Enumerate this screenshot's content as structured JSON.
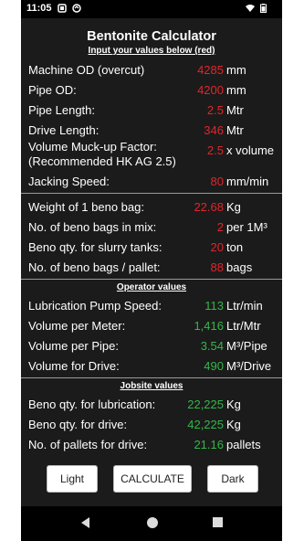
{
  "status": {
    "time": "11:05"
  },
  "app": {
    "title": "Bentonite Calculator",
    "subtitle": "Input your values below (red)"
  },
  "inputs": [
    {
      "label": "Machine OD (overcut)",
      "value": "4285",
      "unit": "mm"
    },
    {
      "label": "Pipe OD:",
      "value": "4200",
      "unit": "mm"
    },
    {
      "label": "Pipe Length:",
      "value": "2.5",
      "unit": "Mtr"
    },
    {
      "label": "Drive Length:",
      "value": "346",
      "unit": "Mtr"
    },
    {
      "label": "Volume Muck-up Factor:",
      "label2": "(Recommended HK AG 2.5)",
      "value": "2.5",
      "unit": "x volume"
    },
    {
      "label": "Jacking Speed:",
      "value": "80",
      "unit": "mm/min"
    }
  ],
  "beno": [
    {
      "label": "Weight of 1 beno bag:",
      "value": "22.68",
      "unit": "Kg"
    },
    {
      "label": "No. of beno bags in mix:",
      "value": "2",
      "unit": "per 1M³"
    },
    {
      "label": "Beno qty. for slurry tanks:",
      "value": "20",
      "unit": "ton"
    },
    {
      "label": "No. of beno bags / pallet:",
      "value": "88",
      "unit": "bags"
    }
  ],
  "operator": {
    "heading": "Operator values",
    "rows": [
      {
        "label": "Lubrication Pump Speed:",
        "value": "113",
        "unit": "Ltr/min"
      },
      {
        "label": "Volume per Meter:",
        "value": "1,416",
        "unit": "Ltr/Mtr"
      },
      {
        "label": "Volume per Pipe:",
        "value": "3.54",
        "unit": "M³/Pipe"
      },
      {
        "label": "Volume for Drive:",
        "value": "490",
        "unit": "M³/Drive"
      }
    ]
  },
  "jobsite": {
    "heading": "Jobsite values",
    "rows": [
      {
        "label": "Beno qty. for lubrication:",
        "value": "22,225",
        "unit": "Kg"
      },
      {
        "label": "Beno qty. for drive:",
        "value": "42,225",
        "unit": "Kg"
      },
      {
        "label": "No. of pallets for drive:",
        "value": "21.16",
        "unit": "pallets"
      }
    ]
  },
  "buttons": {
    "light": "Light",
    "calculate": "CALCULATE",
    "dark": "Dark"
  },
  "colors": {
    "input_value": "#e0262a",
    "result_value": "#35b64a",
    "background": "#1b1b1b"
  },
  "icons": [
    "notification-icon",
    "sync-icon",
    "wifi-icon",
    "battery-icon",
    "nav-back-icon",
    "nav-home-icon",
    "nav-recents-icon"
  ]
}
